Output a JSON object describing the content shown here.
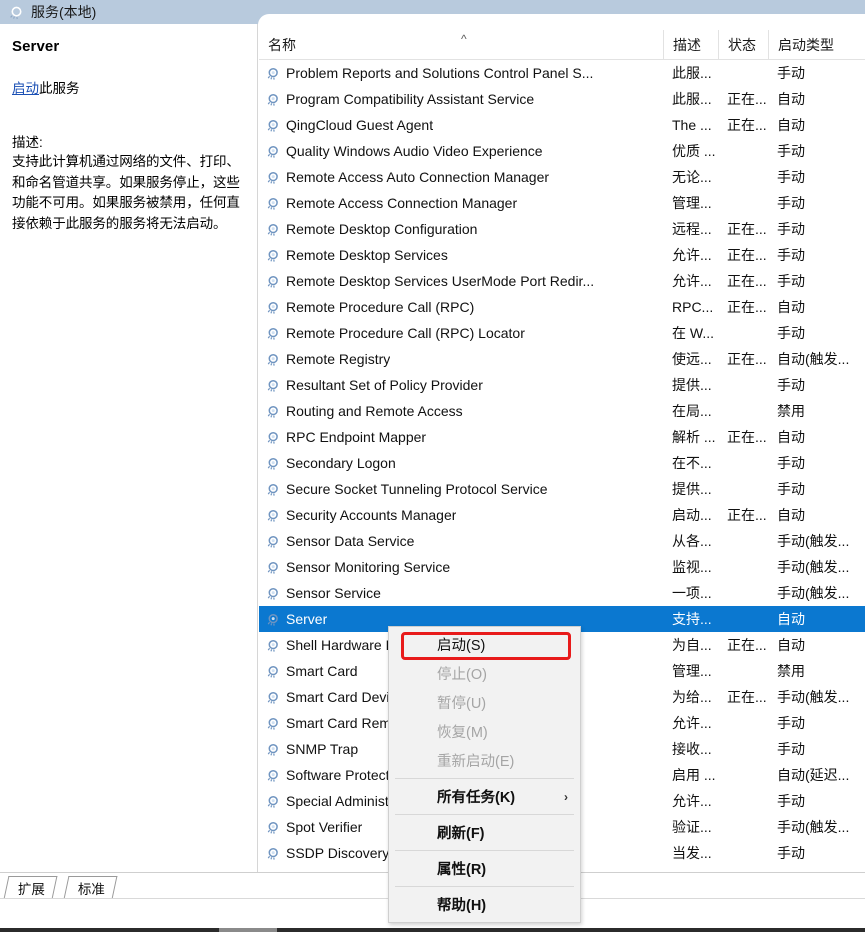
{
  "window": {
    "header_title": "服务(本地)",
    "header_icon": "gear-icon"
  },
  "left_pane": {
    "service_name": "Server",
    "action_link": "启动",
    "action_suffix": "此服务",
    "description_label": "描述:",
    "description_body": "支持此计算机通过网络的文件、打印、和命名管道共享。如果服务停止，这些功能不可用。如果服务被禁用，任何直接依赖于此服务的服务将无法启动。"
  },
  "list": {
    "columns": {
      "name": "名称",
      "description": "描述",
      "status": "状态",
      "startup_type": "启动类型"
    },
    "sort_indicator": "^",
    "rows": [
      {
        "name": "Problem Reports and Solutions Control Panel S...",
        "desc": "此服...",
        "state": "",
        "start": "手动"
      },
      {
        "name": "Program Compatibility Assistant Service",
        "desc": "此服...",
        "state": "正在...",
        "start": "自动"
      },
      {
        "name": "QingCloud Guest Agent",
        "desc": "The ...",
        "state": "正在...",
        "start": "自动"
      },
      {
        "name": "Quality Windows Audio Video Experience",
        "desc": "优质 ...",
        "state": "",
        "start": "手动"
      },
      {
        "name": "Remote Access Auto Connection Manager",
        "desc": "无论...",
        "state": "",
        "start": "手动"
      },
      {
        "name": "Remote Access Connection Manager",
        "desc": "管理...",
        "state": "",
        "start": "手动"
      },
      {
        "name": "Remote Desktop Configuration",
        "desc": "远程...",
        "state": "正在...",
        "start": "手动"
      },
      {
        "name": "Remote Desktop Services",
        "desc": "允许...",
        "state": "正在...",
        "start": "手动"
      },
      {
        "name": "Remote Desktop Services UserMode Port Redir...",
        "desc": "允许...",
        "state": "正在...",
        "start": "手动"
      },
      {
        "name": "Remote Procedure Call (RPC)",
        "desc": "RPC...",
        "state": "正在...",
        "start": "自动"
      },
      {
        "name": "Remote Procedure Call (RPC) Locator",
        "desc": "在 W...",
        "state": "",
        "start": "手动"
      },
      {
        "name": "Remote Registry",
        "desc": "使远...",
        "state": "正在...",
        "start": "自动(触发..."
      },
      {
        "name": "Resultant Set of Policy Provider",
        "desc": "提供...",
        "state": "",
        "start": "手动"
      },
      {
        "name": "Routing and Remote Access",
        "desc": "在局...",
        "state": "",
        "start": "禁用"
      },
      {
        "name": "RPC Endpoint Mapper",
        "desc": "解析 ...",
        "state": "正在...",
        "start": "自动"
      },
      {
        "name": "Secondary Logon",
        "desc": "在不...",
        "state": "",
        "start": "手动"
      },
      {
        "name": "Secure Socket Tunneling Protocol Service",
        "desc": "提供...",
        "state": "",
        "start": "手动"
      },
      {
        "name": "Security Accounts Manager",
        "desc": "启动...",
        "state": "正在...",
        "start": "自动"
      },
      {
        "name": "Sensor Data Service",
        "desc": "从各...",
        "state": "",
        "start": "手动(触发..."
      },
      {
        "name": "Sensor Monitoring Service",
        "desc": "监视...",
        "state": "",
        "start": "手动(触发..."
      },
      {
        "name": "Sensor Service",
        "desc": "一项...",
        "state": "",
        "start": "手动(触发..."
      },
      {
        "name": "Server",
        "desc": "支持...",
        "state": "",
        "start": "自动",
        "selected": true
      },
      {
        "name": "Shell Hardware Detection",
        "desc": "为自...",
        "state": "正在...",
        "start": "自动"
      },
      {
        "name": "Smart Card",
        "desc": "管理...",
        "state": "",
        "start": "禁用"
      },
      {
        "name": "Smart Card Device Enumeration Service",
        "desc": "为给...",
        "state": "正在...",
        "start": "手动(触发..."
      },
      {
        "name": "Smart Card Removal Policy",
        "desc": "允许...",
        "state": "",
        "start": "手动"
      },
      {
        "name": "SNMP Trap",
        "desc": "接收...",
        "state": "",
        "start": "手动"
      },
      {
        "name": "Software Protection",
        "desc": "启用 ...",
        "state": "",
        "start": "自动(延迟..."
      },
      {
        "name": "Special Administration Console Helper",
        "desc": "允许...",
        "state": "",
        "start": "手动"
      },
      {
        "name": "Spot Verifier",
        "desc": "验证...",
        "state": "",
        "start": "手动(触发..."
      },
      {
        "name": "SSDP Discovery",
        "desc": "当发...",
        "state": "",
        "start": "手动"
      }
    ]
  },
  "context_menu": {
    "items": [
      {
        "label": "启动(S)",
        "disabled": false,
        "bold": false,
        "highlighted": true,
        "submenu": false
      },
      {
        "label": "停止(O)",
        "disabled": true,
        "bold": false,
        "highlighted": false,
        "submenu": false
      },
      {
        "label": "暂停(U)",
        "disabled": true,
        "bold": false,
        "highlighted": false,
        "submenu": false
      },
      {
        "label": "恢复(M)",
        "disabled": true,
        "bold": false,
        "highlighted": false,
        "submenu": false
      },
      {
        "label": "重新启动(E)",
        "disabled": true,
        "bold": false,
        "highlighted": false,
        "submenu": false
      },
      {
        "separator": true
      },
      {
        "label": "所有任务(K)",
        "disabled": false,
        "bold": true,
        "highlighted": false,
        "submenu": true
      },
      {
        "separator": true
      },
      {
        "label": "刷新(F)",
        "disabled": false,
        "bold": true,
        "highlighted": false,
        "submenu": false
      },
      {
        "separator": true
      },
      {
        "label": "属性(R)",
        "disabled": false,
        "bold": true,
        "highlighted": false,
        "submenu": false
      },
      {
        "separator": true
      },
      {
        "label": "帮助(H)",
        "disabled": false,
        "bold": true,
        "highlighted": false,
        "submenu": false
      }
    ],
    "submenu_arrow": "›",
    "highlight_color": "#e81b1b"
  },
  "tabs": [
    {
      "label": "扩展",
      "active": true
    },
    {
      "label": "标准",
      "active": false
    }
  ],
  "colors": {
    "header_band": "#b8cadd",
    "selection": "#0b78d0",
    "link": "#1a4fb4",
    "highlight_box": "#e81b1b"
  }
}
